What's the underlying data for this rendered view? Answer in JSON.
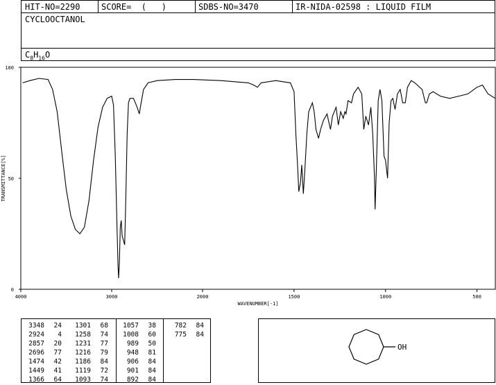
{
  "header": {
    "hit_no": "HIT-NO=2290",
    "score": "SCORE=  (   )",
    "sdbs_no": "SDBS-NO=3470",
    "ir_id": "IR-NIDA-02598 : LIQUID FILM",
    "compound_name": "CYCLOOCTANOL",
    "formula_c": "C",
    "formula_c_sub": "8",
    "formula_h": "H",
    "formula_h_sub": "16",
    "formula_o": "O"
  },
  "chart_data": {
    "type": "line",
    "xlabel": "WAVENUMBER[-1]",
    "ylabel": "TRANSMITTANCE[%]",
    "x_ticks": [
      4000,
      3000,
      2000,
      1500,
      1000,
      500
    ],
    "x_tick_labels": [
      "4000",
      "3000",
      "2000",
      "1500",
      "1000",
      "500"
    ],
    "y_ticks": [
      0,
      50,
      100
    ],
    "y_tick_labels": [
      "0",
      "50",
      "100"
    ],
    "xlim": [
      4000,
      400
    ],
    "ylim": [
      0,
      100
    ],
    "series": [
      {
        "points": [
          [
            3980,
            93
          ],
          [
            3900,
            94
          ],
          [
            3800,
            95
          ],
          [
            3700,
            94.5
          ],
          [
            3650,
            90
          ],
          [
            3600,
            80
          ],
          [
            3550,
            62
          ],
          [
            3500,
            45
          ],
          [
            3450,
            33
          ],
          [
            3400,
            27
          ],
          [
            3350,
            25
          ],
          [
            3300,
            28
          ],
          [
            3250,
            40
          ],
          [
            3200,
            58
          ],
          [
            3150,
            73
          ],
          [
            3100,
            82
          ],
          [
            3050,
            86
          ],
          [
            3000,
            87
          ],
          [
            2980,
            83
          ],
          [
            2960,
            60
          ],
          [
            2940,
            25
          ],
          [
            2930,
            10
          ],
          [
            2924,
            5
          ],
          [
            2915,
            12
          ],
          [
            2905,
            28
          ],
          [
            2895,
            31
          ],
          [
            2885,
            24
          ],
          [
            2870,
            22
          ],
          [
            2857,
            20
          ],
          [
            2845,
            40
          ],
          [
            2830,
            70
          ],
          [
            2815,
            84
          ],
          [
            2800,
            86
          ],
          [
            2760,
            86
          ],
          [
            2720,
            82
          ],
          [
            2696,
            79
          ],
          [
            2680,
            83
          ],
          [
            2650,
            90
          ],
          [
            2600,
            93
          ],
          [
            2500,
            94
          ],
          [
            2300,
            94.5
          ],
          [
            2100,
            94.5
          ],
          [
            1900,
            94
          ],
          [
            1750,
            93
          ],
          [
            1720,
            92
          ],
          [
            1700,
            91
          ],
          [
            1680,
            93
          ],
          [
            1600,
            94
          ],
          [
            1520,
            93
          ],
          [
            1500,
            89
          ],
          [
            1490,
            70
          ],
          [
            1480,
            55
          ],
          [
            1474,
            44
          ],
          [
            1465,
            48
          ],
          [
            1458,
            56
          ],
          [
            1449,
            43
          ],
          [
            1440,
            55
          ],
          [
            1430,
            70
          ],
          [
            1420,
            80
          ],
          [
            1400,
            84
          ],
          [
            1390,
            80
          ],
          [
            1380,
            72
          ],
          [
            1366,
            68
          ],
          [
            1355,
            72
          ],
          [
            1340,
            76
          ],
          [
            1320,
            79
          ],
          [
            1301,
            72
          ],
          [
            1290,
            78
          ],
          [
            1270,
            82
          ],
          [
            1258,
            74
          ],
          [
            1245,
            80
          ],
          [
            1231,
            77
          ],
          [
            1222,
            80
          ],
          [
            1216,
            79
          ],
          [
            1205,
            85
          ],
          [
            1186,
            84
          ],
          [
            1175,
            88
          ],
          [
            1150,
            91
          ],
          [
            1130,
            88
          ],
          [
            1119,
            72
          ],
          [
            1108,
            78
          ],
          [
            1093,
            74
          ],
          [
            1080,
            82
          ],
          [
            1070,
            70
          ],
          [
            1060,
            50
          ],
          [
            1057,
            36
          ],
          [
            1050,
            55
          ],
          [
            1040,
            85
          ],
          [
            1030,
            90
          ],
          [
            1020,
            85
          ],
          [
            1008,
            60
          ],
          [
            1000,
            58
          ],
          [
            989,
            50
          ],
          [
            980,
            75
          ],
          [
            970,
            85
          ],
          [
            960,
            86
          ],
          [
            948,
            81
          ],
          [
            935,
            88
          ],
          [
            920,
            90
          ],
          [
            906,
            84
          ],
          [
            901,
            84
          ],
          [
            892,
            84
          ],
          [
            880,
            91
          ],
          [
            860,
            94
          ],
          [
            840,
            93
          ],
          [
            800,
            90
          ],
          [
            782,
            84
          ],
          [
            775,
            84
          ],
          [
            760,
            88
          ],
          [
            740,
            89
          ],
          [
            700,
            87
          ],
          [
            650,
            86
          ],
          [
            600,
            87
          ],
          [
            550,
            88
          ],
          [
            500,
            91
          ],
          [
            470,
            92
          ],
          [
            440,
            88
          ],
          [
            400,
            86
          ]
        ]
      }
    ]
  },
  "peak_table": {
    "col1_wavenumbers": [
      "3348",
      "2924",
      "2857",
      "2696",
      "1474",
      "1449",
      "1366"
    ],
    "col1_transmittances": [
      "24",
      "4",
      "20",
      "77",
      "42",
      "41",
      "64"
    ],
    "col2_wavenumbers": [
      "1301",
      "1258",
      "1231",
      "1216",
      "1186",
      "1119",
      "1093"
    ],
    "col2_transmittances": [
      "68",
      "74",
      "77",
      "79",
      "84",
      "72",
      "74"
    ],
    "col3_wavenumbers": [
      "1057",
      "1008",
      "989",
      "948",
      "906",
      "901",
      "892"
    ],
    "col3_transmittances": [
      "38",
      "60",
      "50",
      "81",
      "84",
      "84",
      "84"
    ],
    "col4_wavenumbers": [
      "782",
      "775"
    ],
    "col4_transmittances": [
      "84",
      "84"
    ]
  },
  "structure": {
    "oh_label": "OH"
  }
}
